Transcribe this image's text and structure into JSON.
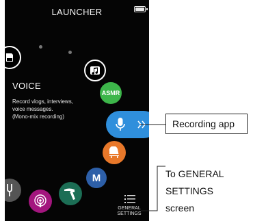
{
  "launcher": {
    "title": "LAUNCHER",
    "selected_app": {
      "name": "VOICE",
      "description": [
        "Record vlogs, interviews,",
        "voice messages.",
        "(Mono-mix recording)"
      ]
    },
    "apps": [
      {
        "icon": "sd-card-icon"
      },
      {
        "icon": "music-playback-icon"
      },
      {
        "label": "ASMR",
        "color": "#3db64a"
      },
      {
        "icon": "microphone-icon",
        "color": "#2f8fdc"
      },
      {
        "icon": "piano-icon",
        "color": "#e8782a"
      },
      {
        "label": "M",
        "color": "#2d5fa8"
      },
      {
        "icon": "tuning-fork-icon",
        "color": "#555555"
      },
      {
        "icon": "podcast-icon",
        "color": "#a3167e"
      },
      {
        "icon": "hammer-icon",
        "color": "#1c6e55"
      }
    ],
    "general_settings_label": [
      "GENERAL",
      "SETTINGS"
    ]
  },
  "callouts": {
    "recording_app": "Recording app",
    "general_settings": [
      "To GENERAL",
      "SETTINGS",
      "screen"
    ]
  }
}
